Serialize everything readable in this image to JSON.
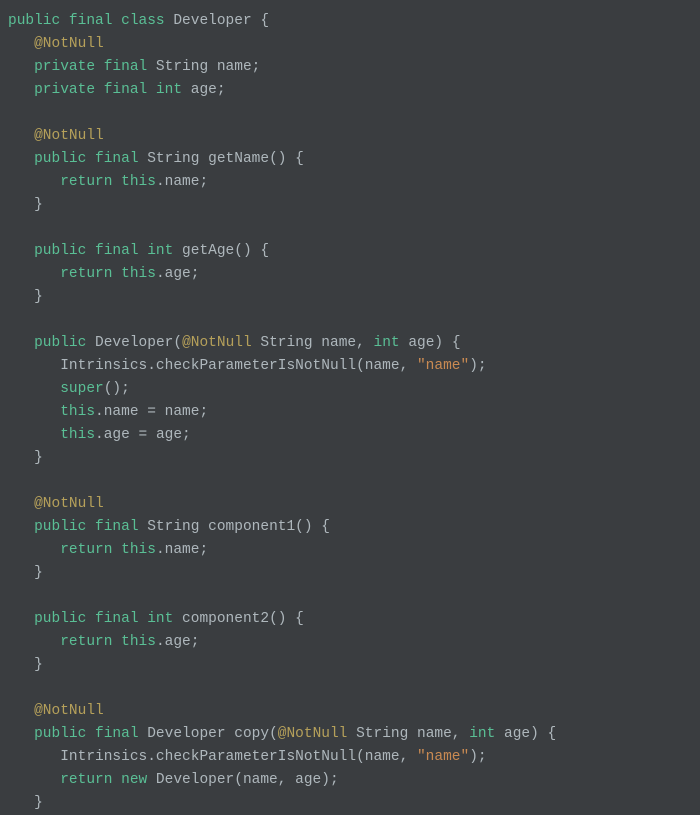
{
  "code": {
    "l1": {
      "t1": "public final class",
      "t2": " Developer {"
    },
    "l2": {
      "t1": "@NotNull"
    },
    "l3": {
      "t1": "private final",
      "t2": " String name;"
    },
    "l4": {
      "t1": "private final int",
      "t2": " age;"
    },
    "l5": {
      "t1": ""
    },
    "l6": {
      "t1": "@NotNull"
    },
    "l7": {
      "t1": "public final",
      "t2": " String ",
      "t3": "getName",
      "t4": "() {"
    },
    "l8": {
      "t1": "return this",
      "t2": ".name;"
    },
    "l9": {
      "t1": "}"
    },
    "l10": {
      "t1": ""
    },
    "l11": {
      "t1": "public final int",
      "t2": " ",
      "t3": "getAge",
      "t4": "() {"
    },
    "l12": {
      "t1": "return this",
      "t2": ".age;"
    },
    "l13": {
      "t1": "}"
    },
    "l14": {
      "t1": ""
    },
    "l15": {
      "t1": "public",
      "t2": " ",
      "t3": "Developer",
      "t4": "(",
      "t5": "@NotNull",
      "t6": " String name, ",
      "t7": "int",
      "t8": " age) {"
    },
    "l16": {
      "t1": "Intrinsics.checkParameterIsNotNull(name, ",
      "t2": "\"name\"",
      "t3": ");"
    },
    "l17": {
      "t1": "super",
      "t2": "();"
    },
    "l18": {
      "t1": "this",
      "t2": ".name = name;"
    },
    "l19": {
      "t1": "this",
      "t2": ".age = age;"
    },
    "l20": {
      "t1": "}"
    },
    "l21": {
      "t1": ""
    },
    "l22": {
      "t1": "@NotNull"
    },
    "l23": {
      "t1": "public final",
      "t2": " String ",
      "t3": "component1",
      "t4": "() {"
    },
    "l24": {
      "t1": "return this",
      "t2": ".name;"
    },
    "l25": {
      "t1": "}"
    },
    "l26": {
      "t1": ""
    },
    "l27": {
      "t1": "public final int",
      "t2": " ",
      "t3": "component2",
      "t4": "() {"
    },
    "l28": {
      "t1": "return this",
      "t2": ".age;"
    },
    "l29": {
      "t1": "}"
    },
    "l30": {
      "t1": ""
    },
    "l31": {
      "t1": "@NotNull"
    },
    "l32": {
      "t1": "public final",
      "t2": " Developer ",
      "t3": "copy",
      "t4": "(",
      "t5": "@NotNull",
      "t6": " String name, ",
      "t7": "int",
      "t8": " age) {"
    },
    "l33": {
      "t1": "Intrinsics.checkParameterIsNotNull(name, ",
      "t2": "\"name\"",
      "t3": ");"
    },
    "l34": {
      "t1": "return new",
      "t2": " Developer(name, age);"
    },
    "l35": {
      "t1": "}"
    }
  }
}
